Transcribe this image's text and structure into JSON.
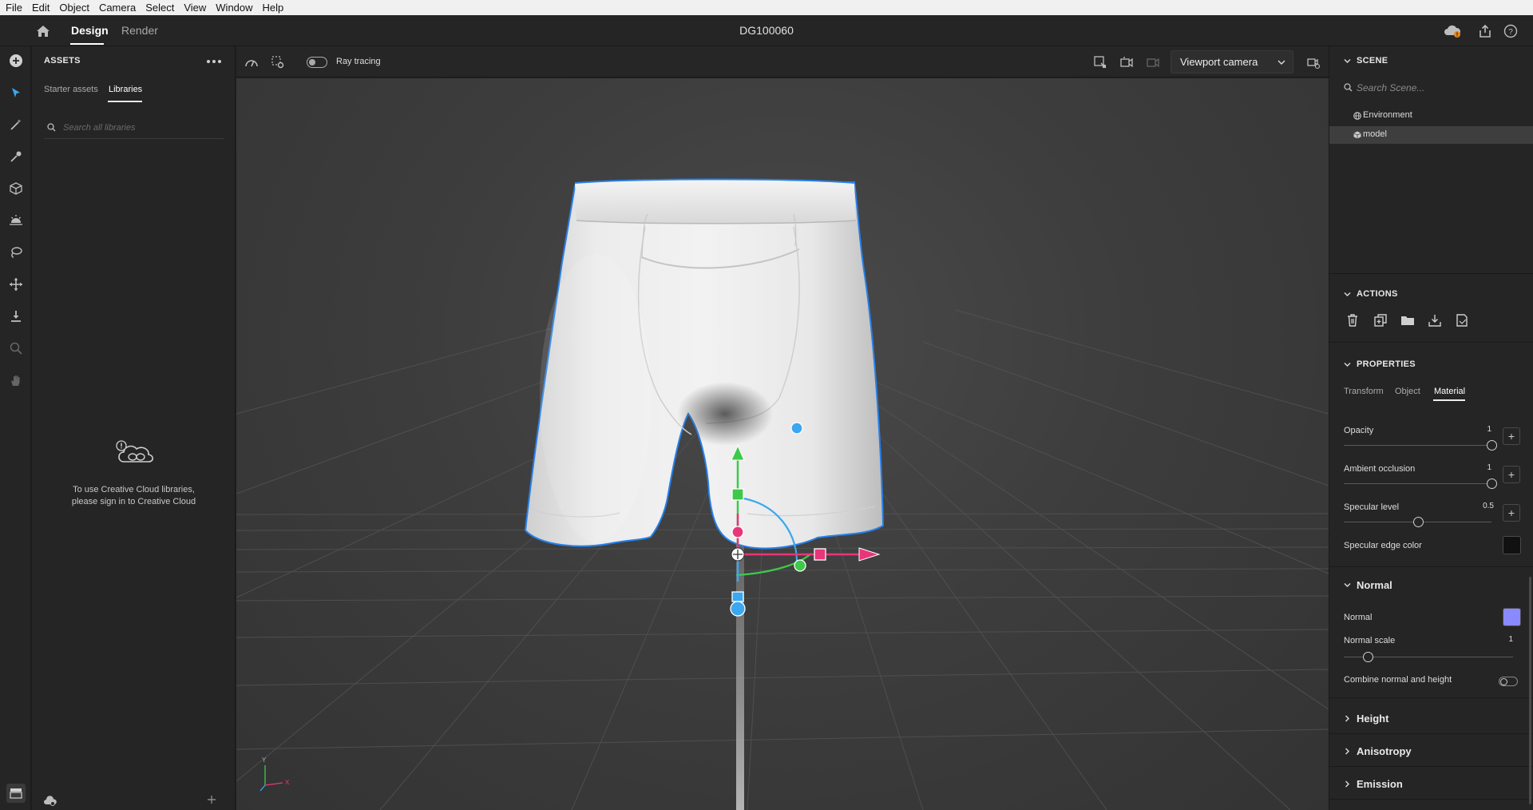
{
  "menu": [
    "File",
    "Edit",
    "Object",
    "Camera",
    "Select",
    "View",
    "Window",
    "Help"
  ],
  "header": {
    "tab_design": "Design",
    "tab_render": "Render",
    "document_title": "DG100060",
    "icons": [
      "cloud-sync-icon",
      "share-icon",
      "help-icon"
    ]
  },
  "tool_rail": [
    "add-icon",
    "select-icon",
    "magic-wand-icon",
    "sampler-icon",
    "cube-icon",
    "light-icon",
    "lasso-icon",
    "move-icon",
    "drop-to-ground-icon",
    "zoom-icon",
    "hand-icon"
  ],
  "assets": {
    "title": "ASSETS",
    "tabs": [
      "Starter assets",
      "Libraries"
    ],
    "selected_tab": "Libraries",
    "search_placeholder": "Search all libraries",
    "signin_message_line1": "To use Creative Cloud libraries,",
    "signin_message_line2": "please sign in to Creative Cloud"
  },
  "viewport_toolbar": {
    "ray_tracing_label": "Ray tracing",
    "ray_tracing_on": false,
    "camera_select": "Viewport camera"
  },
  "viewport": {
    "axis_y": "Y",
    "axis_x": "X"
  },
  "scene": {
    "title": "SCENE",
    "search_placeholder": "Search Scene...",
    "items": [
      {
        "label": "Environment",
        "icon": "globe-icon",
        "selected": false
      },
      {
        "label": "model",
        "icon": "model-icon",
        "selected": true
      }
    ]
  },
  "actions": {
    "title": "ACTIONS",
    "icons": [
      "delete-icon",
      "duplicate-icon",
      "group-icon",
      "export-icon",
      "save-material-icon"
    ]
  },
  "properties": {
    "title": "PROPERTIES",
    "tabs": [
      "Transform",
      "Object",
      "Material"
    ],
    "selected_tab": "Material",
    "opacity": {
      "label": "Opacity",
      "value": "1",
      "fraction": 1.0
    },
    "ambient_occlusion": {
      "label": "Ambient occlusion",
      "value": "1",
      "fraction": 1.0
    },
    "specular_level": {
      "label": "Specular level",
      "value": "0.5",
      "fraction": 0.5
    },
    "specular_edge_color": {
      "label": "Specular edge color",
      "color": "#111111"
    },
    "normal_section": {
      "title": "Normal",
      "normal_label": "Normal",
      "normal_color": "#8a8aff",
      "normal_scale_label": "Normal scale",
      "normal_scale_value": "1",
      "normal_scale_fraction": 0.0,
      "combine_label": "Combine normal and height",
      "combine_on": false
    },
    "collapsed_sections": [
      "Height",
      "Anisotropy",
      "Emission"
    ]
  },
  "colors": {
    "accent_blue": "#2680eb",
    "gizmo_green": "#3ec94a",
    "gizmo_red": "#e8367a",
    "gizmo_blue": "#3aa7f0"
  }
}
